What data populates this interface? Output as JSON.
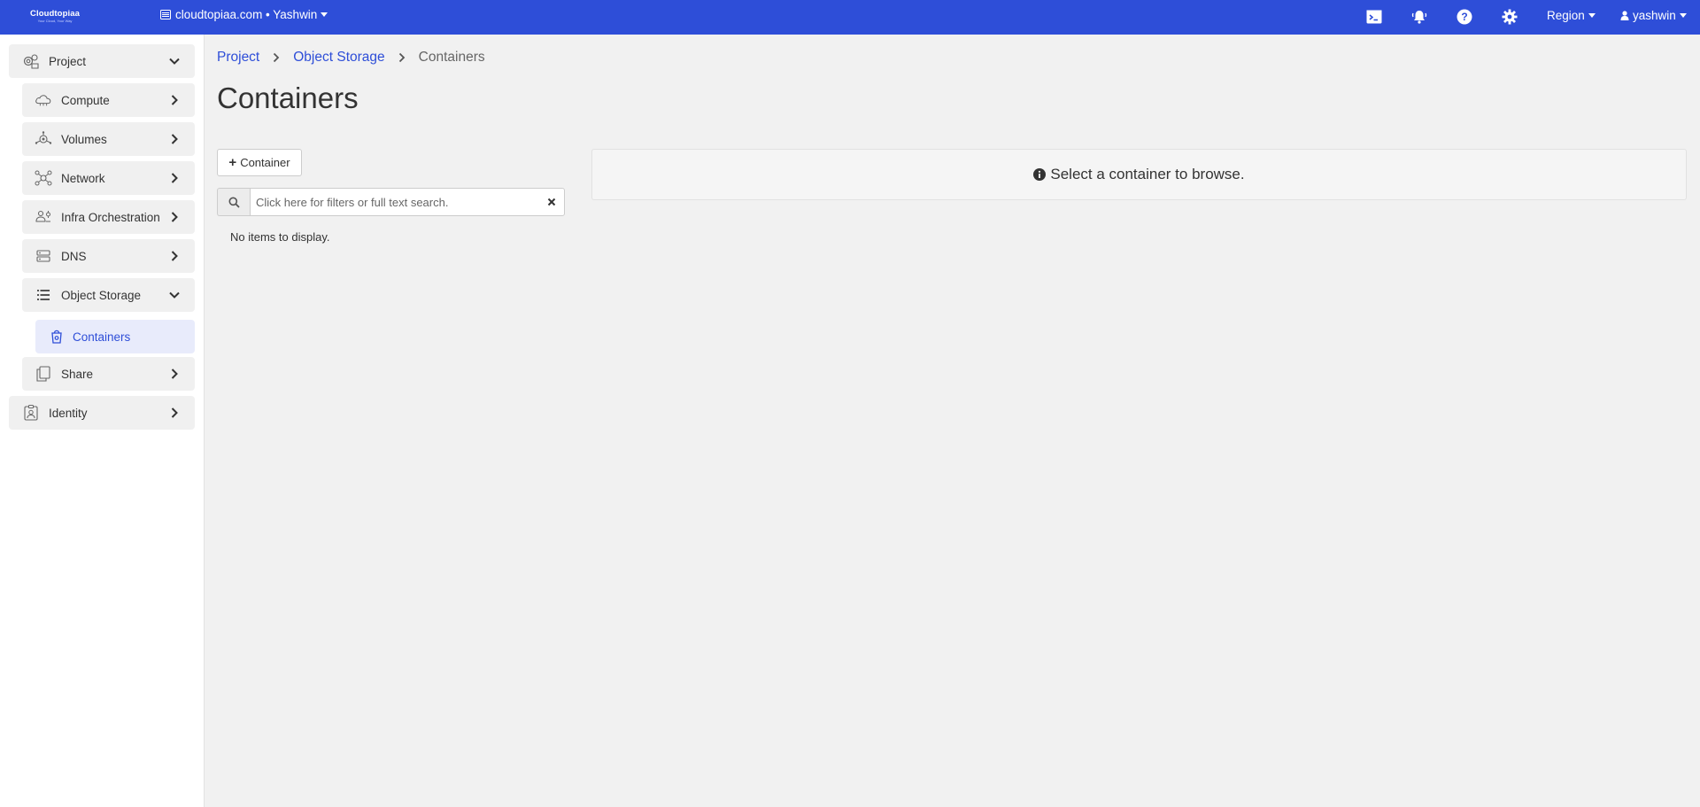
{
  "brand": {
    "name": "Cloudtopiaa",
    "tagline": "Your Cloud, Your Way"
  },
  "topbar": {
    "project_switch": "cloudtopiaa.com • Yashwin",
    "region_label": "Region",
    "user_label": "yashwin",
    "icons": [
      "console-icon",
      "bell-icon",
      "help-icon",
      "gear-icon"
    ]
  },
  "sidebar": {
    "project": "Project",
    "items": [
      {
        "label": "Compute",
        "icon": "cloud-icon"
      },
      {
        "label": "Volumes",
        "icon": "volumes-icon"
      },
      {
        "label": "Network",
        "icon": "network-icon"
      },
      {
        "label": "Infra Orchestration",
        "icon": "orchestration-icon"
      },
      {
        "label": "DNS",
        "icon": "dns-icon"
      },
      {
        "label": "Object Storage",
        "icon": "storage-icon"
      },
      {
        "label": "Containers",
        "icon": "container-icon"
      },
      {
        "label": "Share",
        "icon": "share-icon"
      }
    ],
    "identity": "Identity"
  },
  "breadcrumb": {
    "project": "Project",
    "object_storage": "Object Storage",
    "current": "Containers"
  },
  "page": {
    "title": "Containers",
    "add_button": "Container",
    "search_placeholder": "Click here for filters or full text search.",
    "empty_text": "No items to display.",
    "browse_message": "Select a container to browse."
  },
  "colors": {
    "accent": "#2e4ed8",
    "active_bg": "#e8ebfb",
    "sidebar_item_bg": "#f0f0f0",
    "page_bg": "#f1f1f1"
  }
}
